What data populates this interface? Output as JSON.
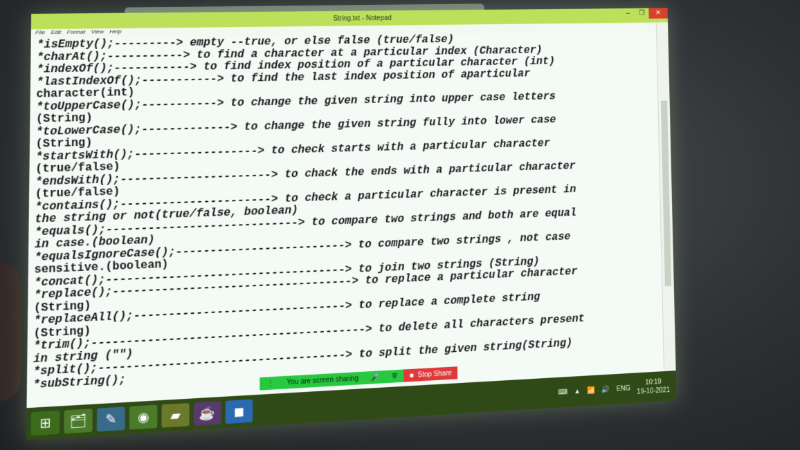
{
  "window": {
    "title": "String.txt - Notepad",
    "minimize": "–",
    "maximize": "❐",
    "close": "✕"
  },
  "menu": [
    "File",
    "Edit",
    "Format",
    "View",
    "Help"
  ],
  "lines": [
    "*isEmpty();---------> empty --true, or else false (true/false)",
    "*charAt();-----------> to find a character at a particular index (Character)",
    "*indexOf();-----------> to find index position of a particular character (int)",
    "*lastIndexOf();-----------> to find the last index position of aparticular",
    "character(int)",
    "*toUpperCase();-----------> to change the given string into upper case letters",
    "(String)",
    "*toLowerCase();-------------> to change the given string fully into lower case",
    "(String)",
    "*startsWith();------------------> to check starts with a particular character",
    "(true/false)",
    "*endsWith();----------------------> to chack the ends with a particular character",
    "(true/false)",
    "*contains();----------------------> to check a particular character is present in",
    "the string or not(true/false, boolean)",
    "*equals();----------------------------> to compare two strings and both are equal",
    "in case.(boolean)",
    "*equalsIgnoreCase();-------------------------> to compare two strings , not case",
    "sensitive.(boolean)",
    "*concat();-----------------------------------> to join two strings (String)",
    "*replace();-----------------------------------> to replace a particular character",
    "(String)",
    "*replaceAll();-------------------------------> to replace a complete string",
    "(String)",
    "*trim();----------------------------------------> to delete all characters present",
    "in string (\"\")",
    "*split();------------------------------------> to split the given string(String)",
    "*subString();"
  ],
  "share_bar": {
    "status": "You are screen sharing",
    "stop": "Stop Share"
  },
  "taskbar": {
    "start_icon": "windows-logo-icon",
    "apps": [
      "file-explorer-icon",
      "notes-icon",
      "chrome-icon",
      "folder-icon",
      "java-ide-icon",
      "zoom-icon"
    ],
    "tray": {
      "language": "ENG",
      "time": "10:19",
      "date": "19-10-2021"
    }
  }
}
